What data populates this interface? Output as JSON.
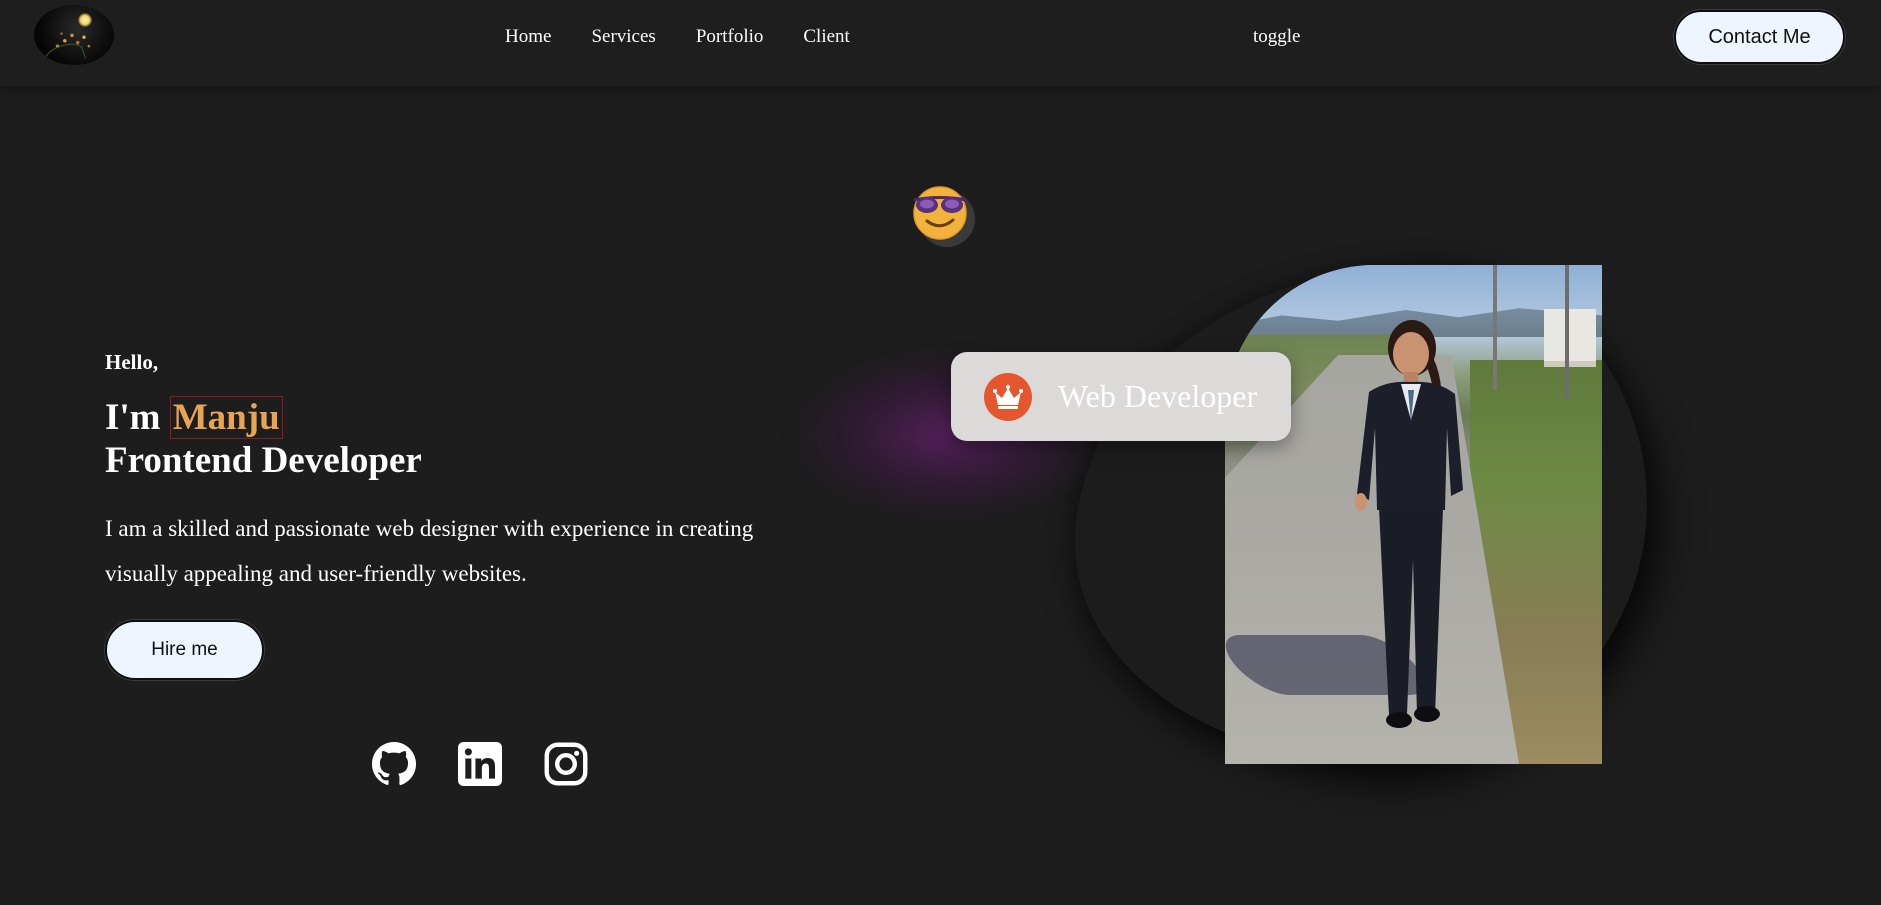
{
  "nav": {
    "links": [
      "Home",
      "Services",
      "Portfolio",
      "Client"
    ],
    "toggle_label": "toggle",
    "contact_label": "Contact Me"
  },
  "hero": {
    "greeting": "Hello,",
    "intro_prefix": "I'm ",
    "name": "Manju",
    "title": "Frontend Developer",
    "description": "I am a skilled and passionate web designer with experience in creating visually appealing and user-friendly websites.",
    "hire_label": "Hire me",
    "socials": [
      "github-icon",
      "linkedin-icon",
      "instagram-icon"
    ]
  },
  "showcase": {
    "emoji": "smiling-face-with-sunglasses-icon",
    "role_icon": "crown-icon",
    "role_label": "Web Developer"
  },
  "colors": {
    "background": "#1d1d1d",
    "name_accent": "#e8a452",
    "button_bg": "#eef5ff",
    "role_card_bg": "#dcd9d9",
    "crown_bg": "#e4572e"
  }
}
